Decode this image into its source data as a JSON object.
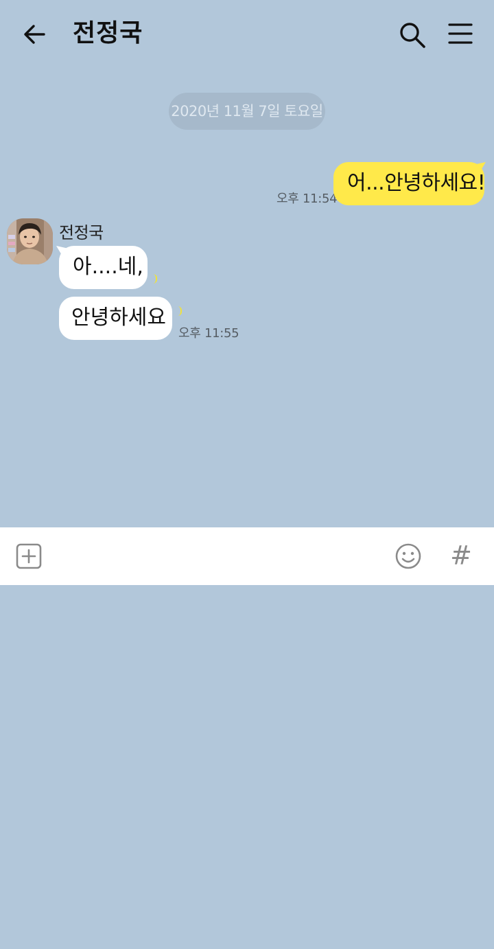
{
  "header": {
    "back_icon": "arrow-left-icon",
    "title": "전정국",
    "search_icon": "search-icon",
    "menu_icon": "hamburger-menu-icon"
  },
  "date_divider": "2020년 11월 7일 토요일",
  "messages": [
    {
      "from": "me",
      "text": "어...안녕하세요!",
      "time": "오후 11:54",
      "bubble_color": "#ffe94a"
    },
    {
      "from": "전정국",
      "text": "아....네,"
    },
    {
      "from": "전정국",
      "text": "안녕하세요",
      "time": "오후 11:55"
    }
  ],
  "composer": {
    "plus_icon": "plus-square-icon",
    "emoji_icon": "smiley-icon",
    "hash_label": "#",
    "input_value": ""
  },
  "colors": {
    "background": "#b2c7da",
    "my_bubble": "#ffe94a",
    "their_bubble": "#ffffff",
    "composer": "#ffffff"
  }
}
